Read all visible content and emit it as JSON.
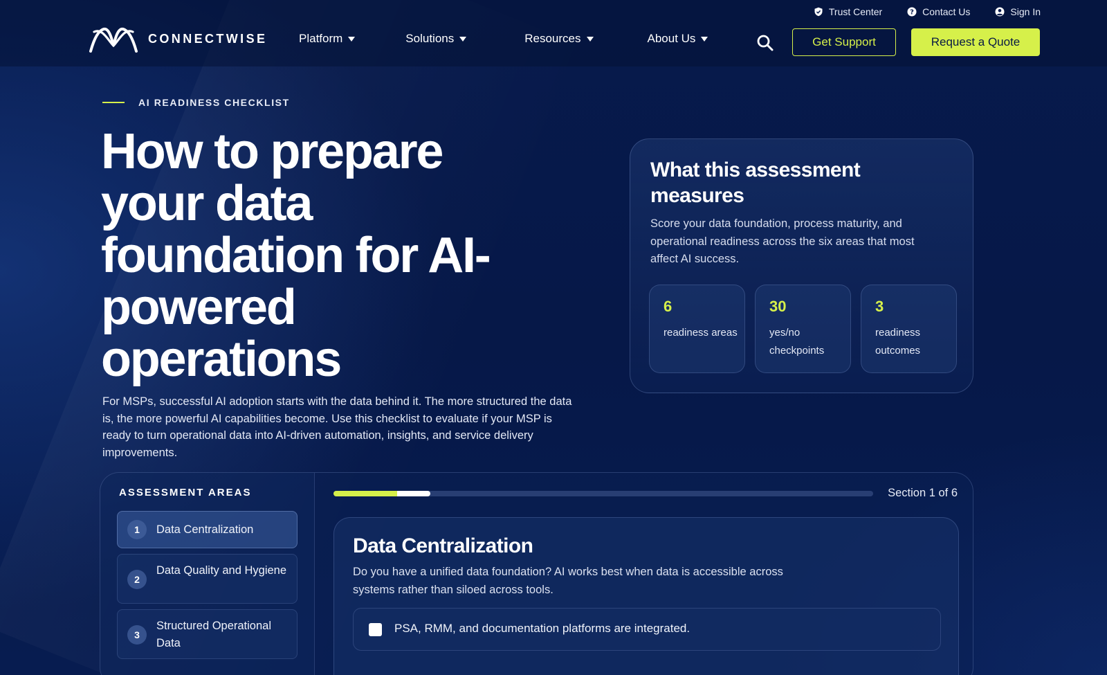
{
  "header": {
    "brand": "CONNECTWISE",
    "utility": [
      {
        "label": "Trust Center",
        "icon": "shield-icon"
      },
      {
        "label": "Contact Us",
        "icon": "help-icon"
      },
      {
        "label": "Sign In",
        "icon": "user-icon"
      }
    ],
    "nav": [
      {
        "label": "Platform"
      },
      {
        "label": "Solutions"
      },
      {
        "label": "Resources"
      },
      {
        "label": "About Us"
      }
    ],
    "support_label": "Get Support",
    "quote_label": "Request a Quote"
  },
  "hero": {
    "eyebrow": "AI READINESS CHECKLIST",
    "title": "How to prepare your data foundation for AI-powered operations",
    "description": "For MSPs, successful AI adoption starts with the data behind it. The more structured the data is, the more powerful AI capabilities become. Use this checklist to evaluate if your MSP is ready to turn operational data into AI-driven automation, insights, and service delivery improvements."
  },
  "measures": {
    "title": "What this assessment measures",
    "description": "Score your data foundation, process maturity, and operational readiness across the six areas that most affect AI success.",
    "stats": [
      {
        "value": "6",
        "label": "readiness areas"
      },
      {
        "value": "30",
        "label": "yes/no checkpoints"
      },
      {
        "value": "3",
        "label": "readiness outcomes"
      }
    ]
  },
  "assessment": {
    "sidebar_title": "ASSESSMENT AREAS",
    "areas": [
      {
        "num": "1",
        "label": "Data Centralization"
      },
      {
        "num": "2",
        "label": "Data Quality and Hygiene"
      },
      {
        "num": "3",
        "label": "Structured Operational Data"
      }
    ],
    "progress_fraction": 0.18,
    "section_counter": "Section 1 of 6",
    "section": {
      "title": "Data Centralization",
      "description": "Do you have a unified data foundation? AI works best when data is accessible across systems rather than siloed across tools.",
      "checkpoints": [
        {
          "label": "PSA, RMM, and documentation platforms are integrated.",
          "checked": false
        }
      ]
    }
  },
  "colors": {
    "accent": "#d6f04a",
    "background": "#061a4a"
  }
}
